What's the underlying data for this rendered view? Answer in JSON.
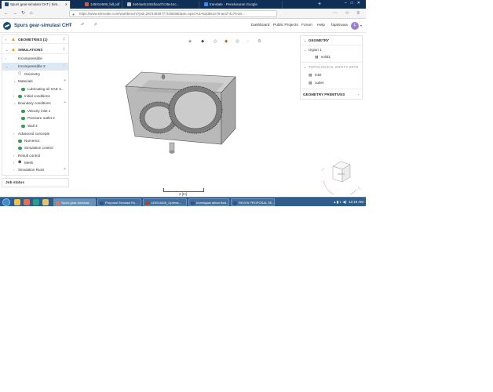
{
  "browser": {
    "tabs": [
      {
        "label": "Spurs gear-simulasi CHT | Sim...",
        "active": true
      },
      {
        "label": "145014608_full.pdf",
        "active": false
      },
      {
        "label": "2e04aeb1262ba1d7c35e14c...",
        "active": false
      },
      {
        "label": "translate - Penelusuran Google",
        "active": false
      }
    ],
    "new_tab": "+",
    "url": "https://www.simscale.com/workbench/?pid=287449297771084960&mi=spec%3A62d8e1e78-ae1f-4175-a0..."
  },
  "app": {
    "project_title": "Spurs gear-simulasi CHT",
    "nav": {
      "dashboard": "Dashboard",
      "public_projects": "Public Projects",
      "forum": "Forum",
      "help": "Help",
      "user": "fajarinava",
      "avatar_letter": "F"
    }
  },
  "tree": {
    "geometries": "GEOMETRIES (1)",
    "simulations": "SIMULATIONS",
    "incompressible": "Incompressible",
    "incompressible2": "Incompressible 2",
    "geometry": "Geometry",
    "materials": "Materials",
    "lubricating": "Lubricating oil SAE 3...",
    "initial_conditions": "Initial conditions",
    "boundary_conditions": "Boundary conditions",
    "velocity_inlet": "Velocity inlet 1",
    "pressure_outlet": "Pressure outlet 2",
    "wall": "Wall 3",
    "advanced_concepts": "Advanced concepts",
    "numerics": "Numerics",
    "simulation_control": "Simulation control",
    "result_control": "Result control",
    "mesh": "Mesh",
    "simulation_runs": "Simulation Runs",
    "job_status": "Job status"
  },
  "right_panel": {
    "geometry_header": "GEOMETRY",
    "region": "region 1",
    "solid": "solid1",
    "topo_header": "TOPOLOGICAL ENTITY SETS",
    "inlet": "inlet",
    "outlet": "outlet",
    "primitives_header": "GEOMETRY PRIMITIVES"
  },
  "viewport": {
    "scale_label": "2 [m]",
    "cube_face": "FRONT"
  },
  "taskbar": {
    "items": [
      "Spurs gear-simulasi...",
      "Proposal Simulasi Ro...",
      "145014845_Optimiz...",
      "Investigasi aliran fluid...",
      "REVISI PROPOSAL SE..."
    ],
    "time": "12:19 AM"
  },
  "colors": {
    "brand": "#1f4d7a",
    "ok": "#2e9e4f",
    "warn": "#e8a317",
    "taskbar": "#2f5e8c",
    "tabbar": "#0f2f57"
  }
}
